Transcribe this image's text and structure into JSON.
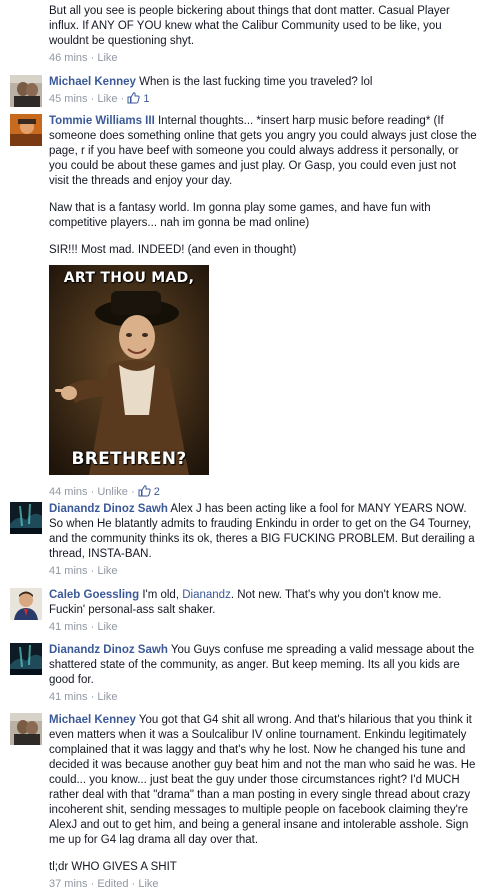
{
  "comments": [
    {
      "text": "But all you see is people bickering about things that dont matter. Casual Player influx. If ANY OF YOU knew what the Calibur Community used to be like, you wouldnt be questioning shyt.",
      "time": "46 mins",
      "like": "Like"
    },
    {
      "name": "Michael Kenney",
      "text": "When is the last fucking time you traveled? lol",
      "time": "45 mins",
      "like": "Like",
      "likes": "1"
    },
    {
      "name": "Tommie Williams III",
      "text1": "Internal thoughts... *insert harp music before reading* (If someone does something online that gets you angry you could always just close the page, r if you have beef with someone you could always address it personally, or you could be about these games and just play. Or Gasp, you could even just not visit the threads and enjoy your day.",
      "text2": "Naw that is a fantasy world. Im gonna play some games, and have fun with competitive players... nah im gonna be mad online)",
      "text3": "SIR!!! Most mad. INDEED! (and even in thought)",
      "meme_top": "ART THOU MAD,",
      "meme_bottom": "BRETHREN?",
      "time": "44 mins",
      "like": "Unlike",
      "likes": "2"
    },
    {
      "name": "Dianandz Dinoz Sawh",
      "text": "Alex J has been acting like a fool for MANY YEARS NOW. So when He blatantly admits to frauding Enkindu in order to get on the G4 Tourney, and the community thinks its ok, theres a BIG FUCKING PROBLEM. But derailing a thread, INSTA-BAN.",
      "time": "41 mins",
      "like": "Like"
    },
    {
      "name": "Caleb Goessling",
      "text_pre": "I'm old,",
      "mention": "Dianandz",
      "text_post": ". Not new. That's why you don't know me. Fuckin' personal-ass salt shaker.",
      "time": "41 mins",
      "like": "Like"
    },
    {
      "name": "Dianandz Dinoz Sawh",
      "text": "You Guys confuse me spreading a valid message about the shattered state of the community, as anger. But keep meming. Its all you kids are good for.",
      "time": "41 mins",
      "like": "Like"
    },
    {
      "name": "Michael Kenney",
      "text1": "You got that G4 shit all wrong. And that's hilarious that you think it even matters when it was a Soulcalibur IV online tournament. Enkindu legitimately complained that it was laggy and that's why he lost. Now he changed his tune and decided it was because another guy beat him and not the man who said he was. He could... you know... just beat the guy under those circumstances right? I'd MUCH rather deal with that \"drama\" than a man posting in every single thread about crazy incoherent shit, sending messages to multiple people on facebook claiming they're AlexJ and out to get him, and being a general insane and intolerable asshole. Sign me up for G4 lag drama all day over that.",
      "text2": "tl;dr WHO GIVES A SHIT",
      "time": "37 mins",
      "edited": "Edited",
      "like": "Like"
    }
  ],
  "colors": {
    "link": "#3b5998",
    "meta": "#9197a3",
    "text": "#141823"
  }
}
